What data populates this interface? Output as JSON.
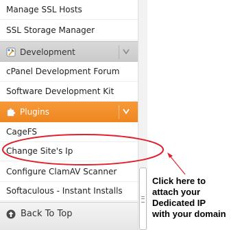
{
  "sidebar": {
    "items_top": [
      {
        "label": "Manage SSL Hosts"
      },
      {
        "label": "SSL Storage Manager"
      }
    ],
    "development": {
      "label": "Development",
      "items": [
        {
          "label": "cPanel Development Forum"
        },
        {
          "label": "Software Development Kit"
        }
      ]
    },
    "plugins": {
      "label": "Plugins",
      "items": [
        {
          "label": "CageFS"
        },
        {
          "label": "Change Site's Ip"
        },
        {
          "label": "Configure ClamAV Scanner"
        },
        {
          "label": "Softaculous - Instant Installs"
        }
      ]
    },
    "back_to_top": "Back To Top"
  },
  "annotation": {
    "lines": [
      "Click here to",
      "attach your",
      "Dedicated IP",
      "with your domain"
    ],
    "color": "#e0202a"
  },
  "colors": {
    "plugins_header": "#f28b26",
    "development_header": "#d2d2d2"
  },
  "icons": {
    "development": "paint-tools-icon",
    "plugins": "puzzle-piece-icon",
    "expand": "chevron-down-icon",
    "back_to_top": "up-arrow-circle-icon",
    "scroll_grip": "scroll-grip-icon"
  }
}
